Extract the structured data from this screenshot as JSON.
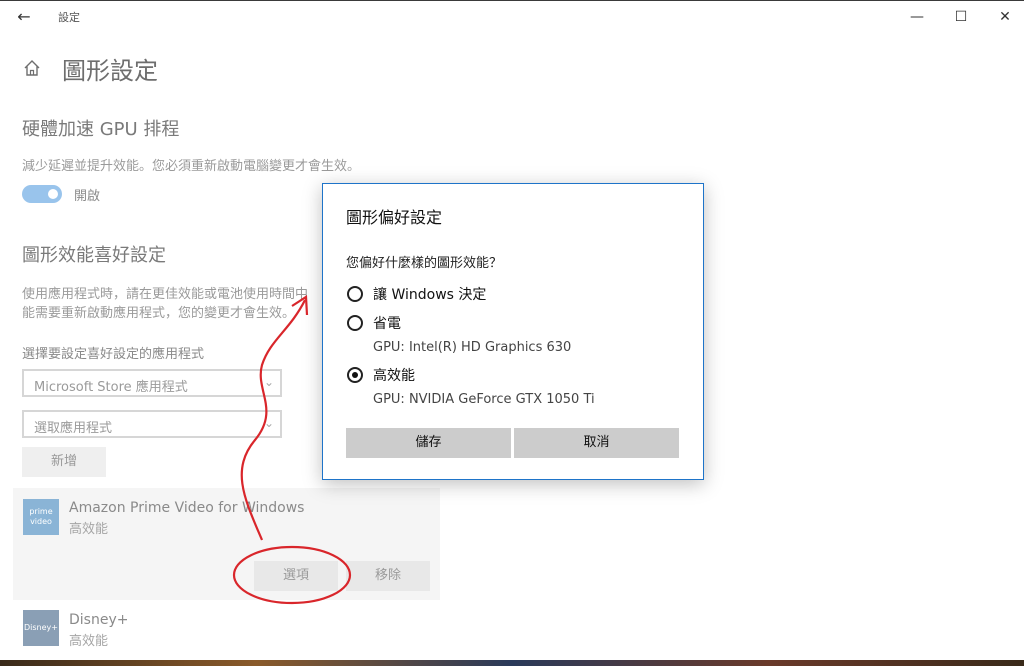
{
  "window": {
    "title": "設定"
  },
  "page": {
    "title": "圖形設定"
  },
  "hags": {
    "heading": "硬體加速 GPU 排程",
    "description": "減少延遲並提升效能。您必須重新啟動電腦變更才會生效。",
    "toggle_label": "開啟",
    "toggle_on": true
  },
  "perf": {
    "heading": "圖形效能喜好設定",
    "desc_line1": "使用應用程式時，請在更佳效能或電池使用時間中",
    "desc_line2": "能需要重新啟動應用程式，您的變更才會生效。",
    "choose_label": "選擇要設定喜好設定的應用程式",
    "app_type_select": "Microsoft Store 應用程式",
    "app_select_placeholder": "選取應用程式",
    "add_button": "新增"
  },
  "apps": [
    {
      "name": "Amazon Prime Video for Windows",
      "pref": "高效能",
      "options_button": "選項",
      "remove_button": "移除",
      "icon": "prime-video-icon",
      "icon_text": "prime video"
    },
    {
      "name": "Disney+",
      "pref": "高效能",
      "icon": "disney-plus-icon",
      "icon_text": "Disney+"
    }
  ],
  "dialog": {
    "title": "圖形偏好設定",
    "question": "您偏好什麼樣的圖形效能？",
    "options": [
      {
        "label": "讓 Windows 決定",
        "sub": "",
        "checked": false
      },
      {
        "label": "省電",
        "sub": "GPU: Intel(R) HD Graphics 630",
        "checked": false
      },
      {
        "label": "高效能",
        "sub": "GPU: NVIDIA GeForce GTX 1050 Ti",
        "checked": true
      }
    ],
    "save_button": "儲存",
    "cancel_button": "取消"
  },
  "colors": {
    "accent": "#1e74c9",
    "toggle": "#99c4ec",
    "annotation": "#d9262b"
  }
}
